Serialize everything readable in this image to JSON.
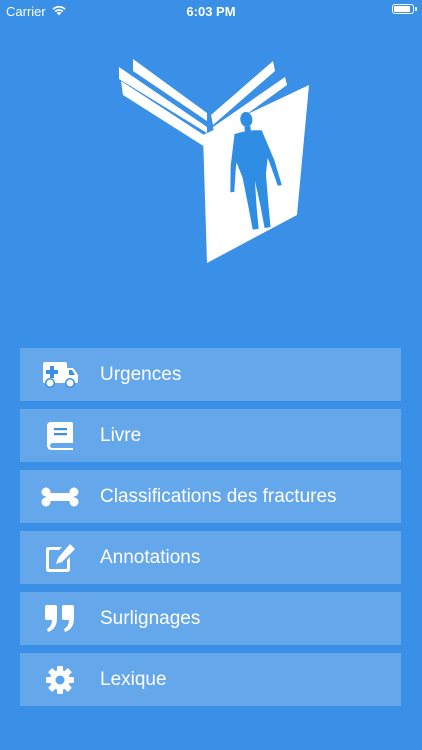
{
  "status_bar": {
    "carrier": "Carrier",
    "time": "6:03 PM",
    "battery_level": 0.95
  },
  "logo": {
    "icon": "book-with-human-body-icon"
  },
  "menu": {
    "items": [
      {
        "label": "Urgences",
        "icon": "ambulance-icon"
      },
      {
        "label": "Livre",
        "icon": "book-icon"
      },
      {
        "label": "Classifications des fractures",
        "icon": "bone-icon"
      },
      {
        "label": "Annotations",
        "icon": "edit-icon"
      },
      {
        "label": "Surlignages",
        "icon": "quote-icon"
      },
      {
        "label": "Lexique",
        "icon": "gear-icon"
      }
    ]
  },
  "colors": {
    "background": "#3a8fe6",
    "menu_item_background": "rgba(255,255,255,0.22)",
    "figure": "#2f8de4",
    "page": "#ffffff"
  }
}
